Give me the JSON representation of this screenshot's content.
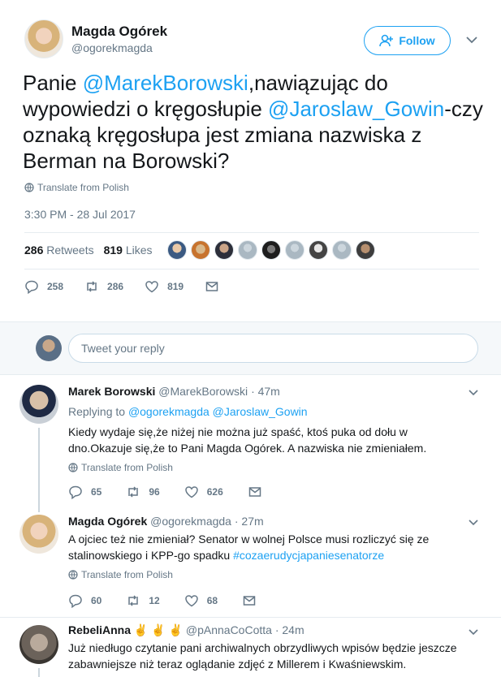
{
  "tweet": {
    "author_name": "Magda Ogórek",
    "author_handle": "@ogorekmagda",
    "follow_label": "Follow",
    "text_parts": [
      "Panie ",
      "@MarekBorowski",
      ",nawiązując do wypowiedzi o kręgosłupie ",
      "@Jaroslaw_Gowin",
      "-czy oznaką kręgosłupa jest zmiana nazwiska z Berman na Borowski?"
    ],
    "translate_label": "Translate from Polish",
    "timestamp": "3:30 PM - 28 Jul 2017",
    "retweets_count": "286",
    "retweets_label": "Retweets",
    "likes_count": "819",
    "likes_label": "Likes",
    "actions": {
      "replies": "258",
      "retweets": "286",
      "likes": "819"
    }
  },
  "reply_box": {
    "placeholder": "Tweet your reply"
  },
  "replies": [
    {
      "name": "Marek Borowski",
      "handle": "@MarekBorowski",
      "time": "· 47m",
      "replying_to_label": "Replying to",
      "replying_to": "@ogorekmagda @Jaroslaw_Gowin",
      "text": "Kiedy wydaje się,że niżej nie można już spaść, ktoś puka od dołu w dno.Okazuje się,że to Pani Magda Ogórek. A nazwiska nie zmieniałem.",
      "translate_label": "Translate from Polish",
      "actions": {
        "replies": "65",
        "retweets": "96",
        "likes": "626"
      }
    },
    {
      "name": "Magda Ogórek",
      "handle": "@ogorekmagda",
      "time": "· 27m",
      "text": "A ojciec też nie zmieniał? Senator w wolnej Polsce musi rozliczyć się ze stalinowskiego i KPP-go spadku ",
      "hashtag": "#cozaerudycjapaniesenatorze",
      "translate_label": "Translate from Polish",
      "actions": {
        "replies": "60",
        "retweets": "12",
        "likes": "68"
      }
    },
    {
      "name": "RebeliAnna",
      "name_emoji": "✌ ✌ ✌",
      "handle": "@pAnnaCoCotta",
      "time": "· 24m",
      "text": "Już niedługo czytanie pani archiwalnych obrzydliwych wpisów będzie jeszcze zabawniejsze niż teraz oglądanie zdjęć z Millerem i Kwaśniewskim."
    }
  ],
  "colors": {
    "accent": "#1da1f2",
    "muted": "#657786",
    "text": "#14171a"
  }
}
